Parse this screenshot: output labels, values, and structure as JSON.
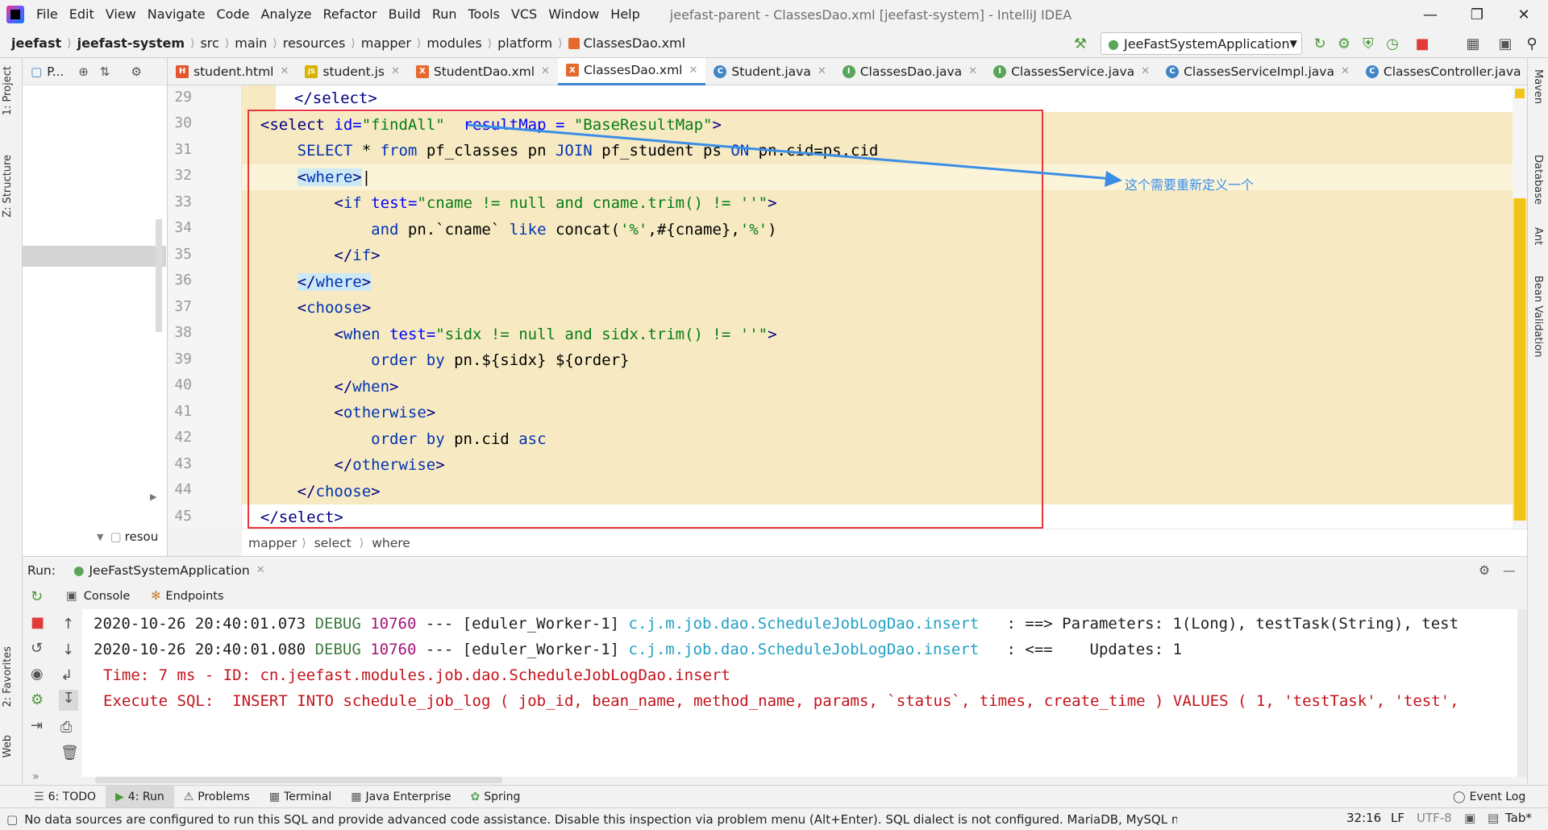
{
  "menu": [
    "File",
    "Edit",
    "View",
    "Navigate",
    "Code",
    "Analyze",
    "Refactor",
    "Build",
    "Run",
    "Tools",
    "VCS",
    "Window",
    "Help"
  ],
  "window_title": "jeefast-parent - ClassesDao.xml [jeefast-system] - IntelliJ IDEA",
  "breadcrumbs": [
    "jeefast",
    "jeefast-system",
    "src",
    "main",
    "resources",
    "mapper",
    "modules",
    "platform",
    "ClassesDao.xml"
  ],
  "run_config": "JeeFastSystemApplication",
  "project_panel": {
    "title": "P...",
    "tree_item": "resou"
  },
  "left_tabs": [
    "1: Project",
    "Z: Structure",
    "2: Favorites",
    "Web"
  ],
  "right_tabs": [
    "Maven",
    "Database",
    "Ant",
    "Bean Validation"
  ],
  "tabs": [
    {
      "label": "student.html",
      "icon": "html-icon",
      "color": "#e4572e",
      "glyph": "H"
    },
    {
      "label": "student.js",
      "icon": "js-icon",
      "color": "#d8b400",
      "glyph": "JS"
    },
    {
      "label": "StudentDao.xml",
      "icon": "xml-icon",
      "color": "#e46a2e",
      "glyph": "X"
    },
    {
      "label": "ClassesDao.xml",
      "icon": "xml-icon",
      "color": "#e46a2e",
      "glyph": "X"
    },
    {
      "label": "Student.java",
      "icon": "class-icon",
      "color": "#3e86c6",
      "glyph": "C"
    },
    {
      "label": "ClassesDao.java",
      "icon": "interface-icon",
      "color": "#5aa55a",
      "glyph": "I"
    },
    {
      "label": "ClassesService.java",
      "icon": "interface-icon",
      "color": "#5aa55a",
      "glyph": "I"
    },
    {
      "label": "ClassesServiceImpl.java",
      "icon": "class-icon",
      "color": "#3e86c6",
      "glyph": "C"
    },
    {
      "label": "ClassesController.java",
      "icon": "class-icon",
      "color": "#3e86c6",
      "glyph": "C"
    }
  ],
  "active_tab": 3,
  "line_numbers": [
    "29",
    "30",
    "31",
    "32",
    "33",
    "34",
    "35",
    "36",
    "37",
    "38",
    "39",
    "40",
    "41",
    "42",
    "43",
    "44",
    "45"
  ],
  "callout": "这个需要重新定义一个",
  "code_breadcrumb": [
    "mapper",
    "select",
    "where"
  ],
  "run": {
    "label": "Run:",
    "app": "JeeFastSystemApplication",
    "console_tab": "Console",
    "endpoints_tab": "Endpoints"
  },
  "console_lines": [
    {
      "ts": "2020-10-26 20:40:01.073",
      "level": "DEBUG",
      "pid": "10760",
      "thread": "--- [eduler_Worker-1]",
      "logger": "c.j.m.job.dao.ScheduleJobLogDao.insert",
      "msg": "   : ==> Parameters: 1(Long), testTask(String), test"
    },
    {
      "ts": "2020-10-26 20:40:01.080",
      "level": "DEBUG",
      "pid": "10760",
      "thread": "--- [eduler_Worker-1]",
      "logger": "c.j.m.job.dao.ScheduleJobLogDao.insert",
      "msg": "   : <==    Updates: 1"
    }
  ],
  "console_time": "Time: 7 ms - ID: cn.jeefast.modules.job.dao.ScheduleJobLogDao.insert",
  "console_sql": "Execute SQL:  INSERT INTO schedule_job_log ( job_id, bean_name, method_name, params, `status`, times, create_time ) VALUES ( 1, 'testTask', 'test',",
  "bottom_tabs": [
    "6: TODO",
    "4: Run",
    "Problems",
    "Terminal",
    "Java Enterprise",
    "Spring"
  ],
  "event_log": "Event Log",
  "status": {
    "message": "No data sources are configured to run this SQL and provide advanced code assistance. Disable this inspection via problem menu (Alt+Enter). SQL dialect is not configured. MariaDB, MySQL match best.",
    "position": "32:16",
    "line_sep": "LF",
    "encoding": "UTF-8",
    "indent": "Tab*"
  },
  "colors": {
    "accent": "#4083c9",
    "highlight": "#f7eac2",
    "box": "#e8363a",
    "callout": "#3a8ee6"
  }
}
